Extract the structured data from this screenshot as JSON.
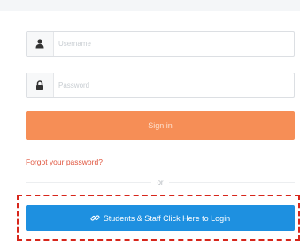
{
  "login": {
    "username_placeholder": "Username",
    "password_placeholder": "Password",
    "signin_label": "Sign in",
    "forgot_label": "Forgot your password?",
    "or_label": "or",
    "sso_label": "Students & Staff Click Here to Login",
    "icons": {
      "username": "user-icon",
      "password": "lock-icon",
      "sso": "link-icon"
    }
  },
  "colors": {
    "signin_button": "#f68e56",
    "forgot_link": "#e0563f",
    "sso_button": "#1e90e0",
    "highlight_border": "#d7261b"
  }
}
